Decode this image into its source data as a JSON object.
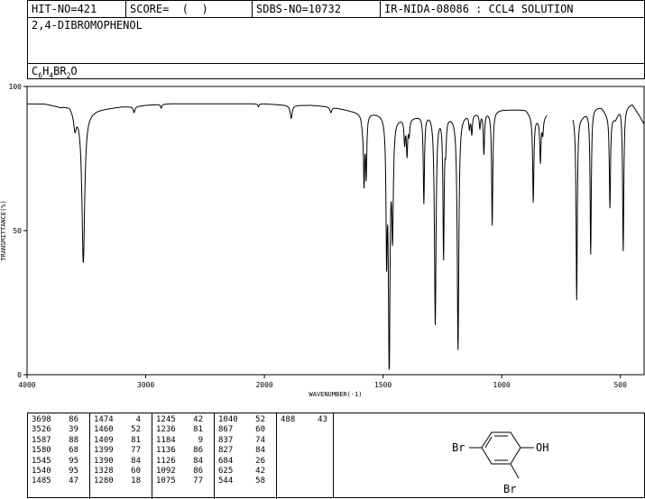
{
  "header": {
    "hit_no": "HIT-NO=421",
    "score": "SCORE=  (  )",
    "sdbs_no": "SDBS-NO=10732",
    "ir_nida": "IR-NIDA-08086 : CCL4 SOLUTION"
  },
  "compound": {
    "name": "2,4-DIBROMOPHENOL",
    "formula": [
      {
        "t": "C",
        "sub": false
      },
      {
        "t": "6",
        "sub": true
      },
      {
        "t": "H",
        "sub": false
      },
      {
        "t": "4",
        "sub": true
      },
      {
        "t": "BR",
        "sub": false
      },
      {
        "t": "2",
        "sub": true
      },
      {
        "t": "O",
        "sub": false
      }
    ]
  },
  "chart_data": {
    "type": "line",
    "title": "",
    "xlabel": "WAVENUMBER(-1)",
    "ylabel": "TRANSMITTANCE(%)",
    "xlim": [
      4000,
      400
    ],
    "ylim": [
      0,
      100
    ],
    "x_ticks": [
      "4000",
      "3000",
      "2000",
      "1500",
      "1000",
      "500"
    ],
    "y_ticks": [
      "100",
      "50",
      "0"
    ],
    "grid": false,
    "baseline": [
      [
        4000,
        94
      ],
      [
        3850,
        94
      ],
      [
        3720,
        93
      ],
      [
        3640,
        93.5
      ],
      [
        3590,
        91
      ],
      [
        3500,
        91
      ],
      [
        3400,
        92
      ],
      [
        3200,
        93
      ],
      [
        3100,
        93
      ],
      [
        3000,
        93.5
      ],
      [
        2800,
        94
      ],
      [
        2400,
        94
      ],
      [
        2000,
        94
      ],
      [
        1900,
        93.5
      ],
      [
        1800,
        93.5
      ],
      [
        1720,
        93
      ],
      [
        1660,
        92
      ],
      [
        1600,
        91
      ],
      [
        1500,
        91
      ],
      [
        1460,
        90
      ],
      [
        1400,
        89
      ],
      [
        1300,
        91
      ],
      [
        1200,
        90
      ],
      [
        1100,
        91
      ],
      [
        1000,
        92
      ],
      [
        900,
        92
      ],
      [
        860,
        89
      ],
      [
        830,
        89
      ],
      [
        790,
        92
      ],
      [
        720,
        92
      ],
      [
        690,
        90
      ],
      [
        660,
        90
      ],
      [
        620,
        93
      ],
      [
        580,
        93
      ],
      [
        560,
        91
      ],
      [
        520,
        89
      ],
      [
        500,
        93
      ],
      [
        450,
        94
      ],
      [
        420,
        90
      ],
      [
        400,
        87
      ]
    ],
    "peaks": [
      {
        "x": 3596,
        "y": 86,
        "w": 12
      },
      {
        "x": 3526,
        "y": 39,
        "w": 14
      },
      {
        "x": 3098,
        "y": 91,
        "w": 8
      },
      {
        "x": 2870,
        "y": 92.5,
        "w": 6
      },
      {
        "x": 2050,
        "y": 93,
        "w": 6
      },
      {
        "x": 1887,
        "y": 89,
        "w": 5
      },
      {
        "x": 1720,
        "y": 91,
        "w": 5
      },
      {
        "x": 1587,
        "y": 88,
        "w": 5
      },
      {
        "x": 1580,
        "y": 68,
        "w": 3
      },
      {
        "x": 1571,
        "y": 70,
        "w": 3
      },
      {
        "x": 1545,
        "y": 95,
        "w": 3
      },
      {
        "x": 1540,
        "y": 95,
        "w": 3
      },
      {
        "x": 1485,
        "y": 47,
        "w": 3
      },
      {
        "x": 1474,
        "y": 4,
        "w": 4
      },
      {
        "x": 1460,
        "y": 52,
        "w": 4
      },
      {
        "x": 1409,
        "y": 81,
        "w": 3
      },
      {
        "x": 1399,
        "y": 77,
        "w": 3
      },
      {
        "x": 1390,
        "y": 84,
        "w": 3
      },
      {
        "x": 1328,
        "y": 60,
        "w": 3
      },
      {
        "x": 1280,
        "y": 18,
        "w": 4
      },
      {
        "x": 1245,
        "y": 42,
        "w": 3
      },
      {
        "x": 1236,
        "y": 81,
        "w": 3
      },
      {
        "x": 1184,
        "y": 9,
        "w": 4
      },
      {
        "x": 1136,
        "y": 86,
        "w": 3
      },
      {
        "x": 1126,
        "y": 84,
        "w": 3
      },
      {
        "x": 1092,
        "y": 86,
        "w": 3
      },
      {
        "x": 1075,
        "y": 77,
        "w": 3
      },
      {
        "x": 1040,
        "y": 52,
        "w": 3
      },
      {
        "x": 867,
        "y": 60,
        "w": 3
      },
      {
        "x": 837,
        "y": 74,
        "w": 3
      },
      {
        "x": 827,
        "y": 84,
        "w": 3
      },
      {
        "x": 684,
        "y": 26,
        "w": 3
      },
      {
        "x": 625,
        "y": 42,
        "w": 3
      },
      {
        "x": 544,
        "y": 58,
        "w": 3
      },
      {
        "x": 488,
        "y": 43,
        "w": 3
      }
    ],
    "gaps": [
      [
        810,
        700
      ]
    ],
    "peak_table": [
      [
        {
          "wn": "3698",
          "t": "86"
        },
        {
          "wn": "3526",
          "t": "39"
        },
        {
          "wn": "1587",
          "t": "88"
        },
        {
          "wn": "1580",
          "t": "68"
        },
        {
          "wn": "1545",
          "t": "95"
        },
        {
          "wn": "1540",
          "t": "95"
        },
        {
          "wn": "1485",
          "t": "47"
        }
      ],
      [
        {
          "wn": "1474",
          "t": "4"
        },
        {
          "wn": "1460",
          "t": "52"
        },
        {
          "wn": "1409",
          "t": "81"
        },
        {
          "wn": "1399",
          "t": "77"
        },
        {
          "wn": "1390",
          "t": "84"
        },
        {
          "wn": "1328",
          "t": "60"
        },
        {
          "wn": "1280",
          "t": "18"
        }
      ],
      [
        {
          "wn": "1245",
          "t": "42"
        },
        {
          "wn": "1236",
          "t": "81"
        },
        {
          "wn": "1184",
          "t": "9"
        },
        {
          "wn": "1136",
          "t": "86"
        },
        {
          "wn": "1126",
          "t": "84"
        },
        {
          "wn": "1092",
          "t": "86"
        },
        {
          "wn": "1075",
          "t": "77"
        }
      ],
      [
        {
          "wn": "1040",
          "t": "52"
        },
        {
          "wn": "867",
          "t": "60"
        },
        {
          "wn": "837",
          "t": "74"
        },
        {
          "wn": "827",
          "t": "84"
        },
        {
          "wn": "684",
          "t": "26"
        },
        {
          "wn": "625",
          "t": "42"
        },
        {
          "wn": "544",
          "t": "58"
        }
      ],
      [
        {
          "wn": "488",
          "t": "43"
        }
      ]
    ]
  },
  "structure": {
    "label_br_left": "Br",
    "label_oh": "OH",
    "label_br_bottom": "Br"
  }
}
